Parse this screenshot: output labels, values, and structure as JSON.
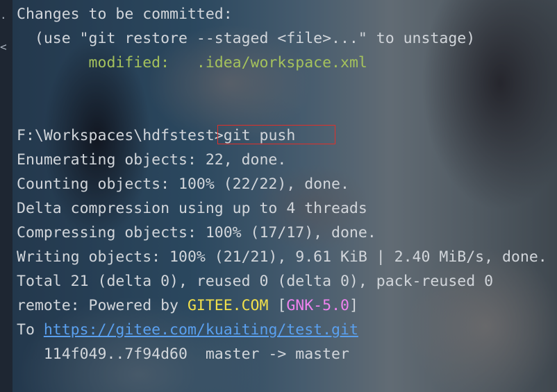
{
  "terminal": {
    "gutter_marks": [
      ".",
      "<"
    ],
    "status_header": "Changes to be committed:",
    "restore_hint": "  (use \"git restore --staged <file>...\" to unstage)",
    "modified_label": "        modified:",
    "modified_file": "   .idea/workspace.xml",
    "prompt_path": "F:\\Workspaces\\hdfstest>",
    "command": "git push",
    "output": [
      "Enumerating objects: 22, done.",
      "Counting objects: 100% (22/22), done.",
      "Delta compression using up to 4 threads",
      "Compressing objects: 100% (17/17), done.",
      "Writing objects: 100% (21/21), 9.61 KiB | 2.40 MiB/s, done.",
      "Total 21 (delta 0), reused 0 (delta 0), pack-reused 0"
    ],
    "remote_prefix": "remote: Powered by ",
    "remote_brand": "GITEE.COM",
    "remote_bracket_open": " [",
    "remote_version": "GNK-5.0",
    "remote_bracket_close": "]",
    "to_prefix": "To ",
    "remote_url": "https://gitee.com/kuaiting/test.git",
    "ref_update": "   114f049..7f94d60  master -> master"
  },
  "colors": {
    "text": "#d2d6db",
    "modified": "#a5c25c",
    "brand": "#f3e14b",
    "version": "#ee82ee",
    "link": "#5aa0ef",
    "highlight_box": "#e0302a"
  }
}
